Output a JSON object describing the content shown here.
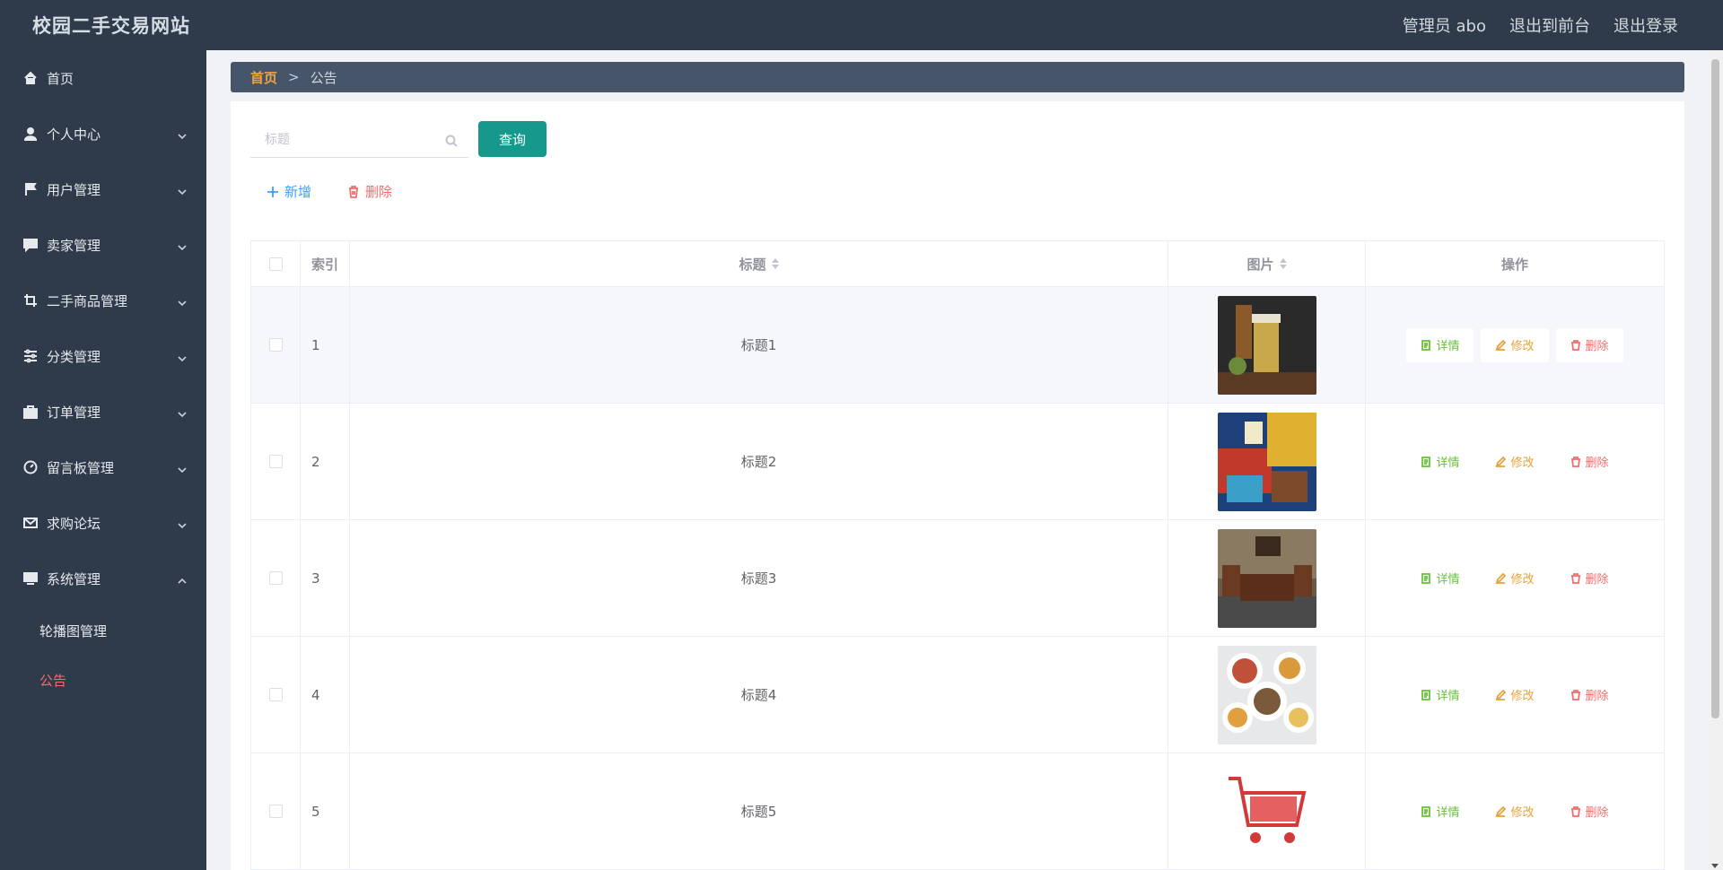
{
  "header": {
    "brand": "校园二手交易网站",
    "admin": "管理员 abo",
    "front": "退出到前台",
    "logout": "退出登录"
  },
  "sidebar": {
    "items": [
      {
        "label": "首页",
        "icon": "home-icon"
      },
      {
        "label": "个人中心",
        "icon": "user-icon"
      },
      {
        "label": "用户管理",
        "icon": "flag-icon"
      },
      {
        "label": "卖家管理",
        "icon": "chat-icon"
      },
      {
        "label": "二手商品管理",
        "icon": "crop-icon"
      },
      {
        "label": "分类管理",
        "icon": "sliders-icon"
      },
      {
        "label": "订单管理",
        "icon": "briefcase-icon"
      },
      {
        "label": "留言板管理",
        "icon": "dashboard-icon"
      },
      {
        "label": "求购论坛",
        "icon": "mail-icon"
      },
      {
        "label": "系统管理",
        "icon": "system-icon"
      }
    ],
    "subitems": [
      {
        "label": "轮播图管理"
      },
      {
        "label": "公告"
      }
    ]
  },
  "breadcrumb": {
    "home": "首页",
    "sep": ">",
    "current": "公告"
  },
  "search": {
    "placeholder": "标题",
    "button": "查询"
  },
  "actions": {
    "add": "新增",
    "delete": "删除"
  },
  "table": {
    "headers": {
      "index": "索引",
      "title": "标题",
      "image": "图片",
      "op": "操作"
    },
    "rows": [
      {
        "index": "1",
        "title": "标题1"
      },
      {
        "index": "2",
        "title": "标题2"
      },
      {
        "index": "3",
        "title": "标题3"
      },
      {
        "index": "4",
        "title": "标题4"
      },
      {
        "index": "5",
        "title": "标题5"
      }
    ],
    "ops": {
      "detail": "详情",
      "edit": "修改",
      "delete": "删除"
    }
  },
  "colors": {
    "topbar": "#2f3a4a",
    "query": "#17988c",
    "active": "#f56c6c",
    "breadcrumb_home": "#f0a33a"
  }
}
